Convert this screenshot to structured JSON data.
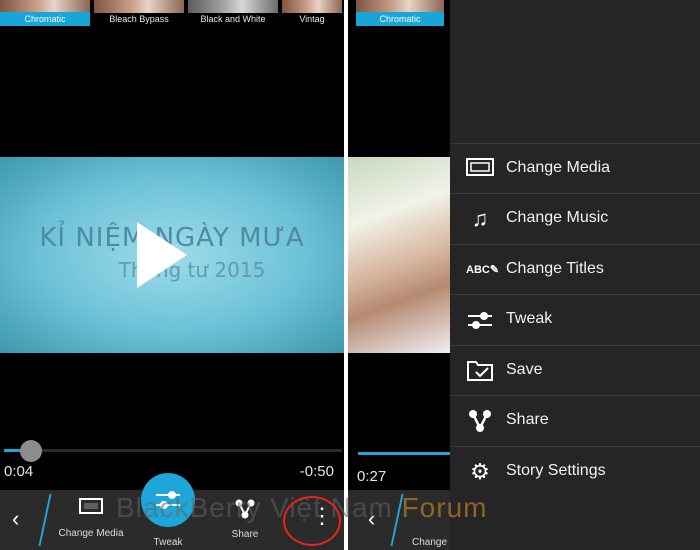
{
  "left": {
    "filters": [
      {
        "label": "Chromatic",
        "selected": true
      },
      {
        "label": "Bleach Bypass",
        "selected": false
      },
      {
        "label": "Black and White",
        "selected": false
      },
      {
        "label": "Vintag",
        "selected": false
      }
    ],
    "video": {
      "title": "KỈ NIỆM NGÀY MƯA",
      "subtitle": "Tháng tư 2015",
      "progress": 0.05
    },
    "time_elapsed": "0:04",
    "time_remaining": "-0:50",
    "action_bar": {
      "change_media_label": "Change Media",
      "tweak_label": "Tweak",
      "share_label": "Share"
    }
  },
  "watermark": {
    "brand": "BlackBerry Việt Nam",
    "forum": "Forum"
  },
  "right": {
    "filter_label": "Chromatic",
    "time_elapsed": "0:27",
    "bar_label": "Change",
    "menu": [
      {
        "label": "Change Media",
        "icon": "film-icon"
      },
      {
        "label": "Change Music",
        "icon": "music-note-icon"
      },
      {
        "label": "Change Titles",
        "icon": "abc-pencil-icon"
      },
      {
        "label": "Tweak",
        "icon": "sliders-icon"
      },
      {
        "label": "Save",
        "icon": "folder-check-icon"
      },
      {
        "label": "Share",
        "icon": "share-nodes-icon"
      },
      {
        "label": "Story Settings",
        "icon": "gear-icon"
      }
    ]
  },
  "colors": {
    "accent": "#1ea6db",
    "annotation": "#e2261d"
  }
}
